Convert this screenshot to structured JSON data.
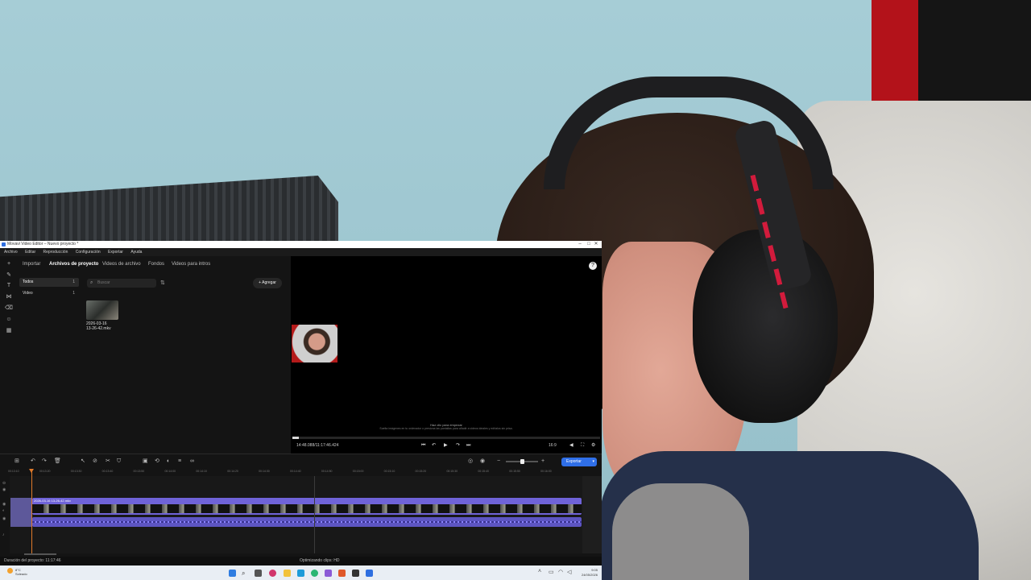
{
  "window": {
    "title": "Movavi Video Editor – Nuevo proyecto *",
    "controls": [
      "–",
      "□",
      "✕"
    ]
  },
  "menu": [
    "Archivo",
    "Editar",
    "Reproducción",
    "Configuración",
    "Exportar",
    "Ayuda"
  ],
  "left_rail_icons": [
    "plus-icon",
    "brush-icon",
    "text-icon",
    "transitions-icon",
    "eraser-icon",
    "sticker-icon",
    "more-tools-icon"
  ],
  "tabs": [
    "Importar",
    "Archivos de proyecto",
    "Videos de archivo",
    "Fondos",
    "Videos para intros"
  ],
  "active_tab": "Archivos de proyecto",
  "categories": [
    {
      "label": "Todos",
      "count": "1"
    },
    {
      "label": "Video",
      "count": "1"
    }
  ],
  "search": {
    "placeholder": "Buscar"
  },
  "add_button": "Agregar",
  "media_file": {
    "name_line1": "2026-03-16",
    "name_line2": "13-26-42.mkv"
  },
  "preview": {
    "hint_line1": "Haz clic para empezar",
    "hint_line2": "Suelta imágenes en tu ordenador o presiona las pantallas para añadir a videos ideales y edítalos sin prisa.",
    "timecode": "14:48.088/11:17:46.424",
    "ratio": "16:9",
    "progress": 0.02
  },
  "timeline": {
    "ruler": [
      "00:13:10",
      "00:13:20",
      "00:13:30",
      "00:13:40",
      "00:13:50",
      "00:14:00",
      "00:14:10",
      "00:14:20",
      "00:14:30",
      "00:14:40",
      "00:14:50",
      "00:15:00",
      "00:15:10",
      "00:15:20",
      "00:15:30",
      "00:15:40",
      "00:15:50",
      "00:16:00"
    ],
    "clip_label": "2026-03-16 13-26-42.mkv",
    "export_label": "Exportar"
  },
  "status": {
    "duration": "Duración del proyecto: 11:17:46",
    "optimizing": "Optimizando clips: HD"
  },
  "taskbar": {
    "temperature": "8°C",
    "weather": "Soleado",
    "time": "9:05",
    "date": "24/05/2026"
  },
  "colors": {
    "accent": "#2f6fe8",
    "clip_video": "#6f63d8",
    "clip_audio": "#5d55c2",
    "playhead": "#e07a2a"
  }
}
